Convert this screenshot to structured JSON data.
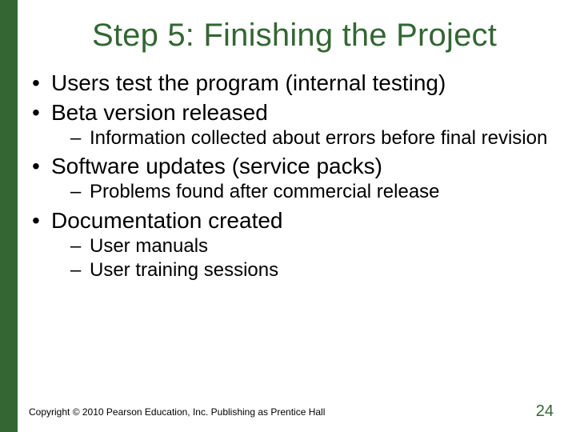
{
  "accent_color": "#336633",
  "title": "Step 5: Finishing the Project",
  "bullets": {
    "b0": "Users test the program (internal testing)",
    "b1": "Beta version released",
    "b1_sub": {
      "s0": "Information collected about errors before final revision"
    },
    "b2": "Software updates (service packs)",
    "b2_sub": {
      "s0": "Problems found after commercial release"
    },
    "b3": "Documentation created",
    "b3_sub": {
      "s0": "User manuals",
      "s1": "User training sessions"
    }
  },
  "footer": {
    "copyright": "Copyright © 2010 Pearson Education, Inc. Publishing as Prentice Hall",
    "page": "24"
  }
}
